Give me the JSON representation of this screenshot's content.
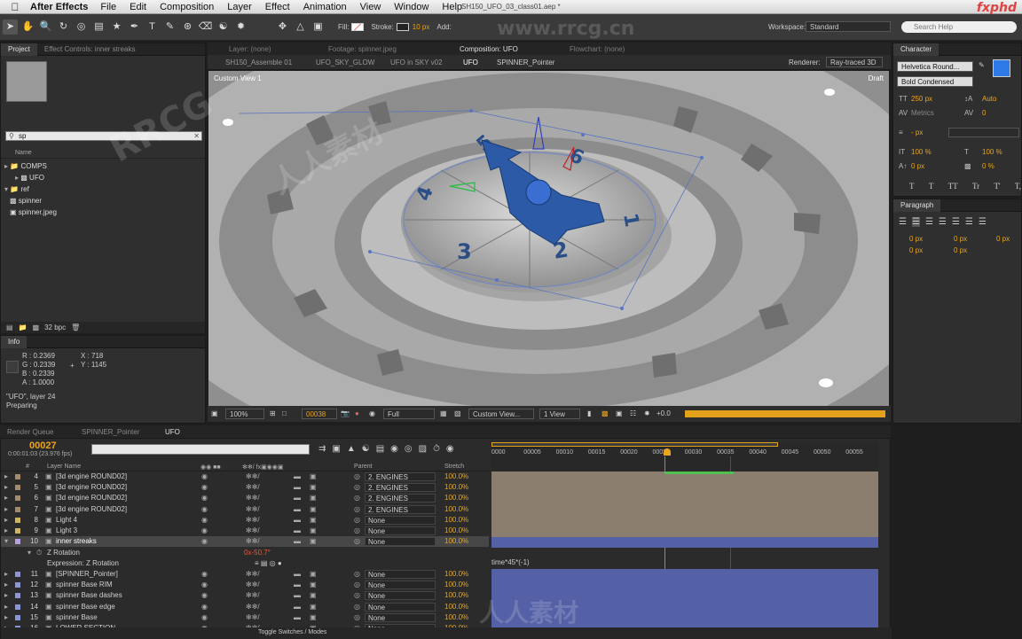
{
  "menubar": {
    "app": "After Effects",
    "items": [
      "File",
      "Edit",
      "Composition",
      "Layer",
      "Effect",
      "Animation",
      "View",
      "Window",
      "Help"
    ],
    "document": "SH150_UFO_03_class01.aep *"
  },
  "toolbar": {
    "fill_label": "Fill:",
    "stroke_label": "Stroke:",
    "stroke_width": "10 px",
    "add_label": "Add:",
    "workspace_label": "Workspace:",
    "workspace_value": "Standard",
    "search_placeholder": "Search Help"
  },
  "project": {
    "tabs": [
      "Project",
      "Effect Controls: inner streaks"
    ],
    "search_value": "sp",
    "column_name": "Name",
    "tree": [
      {
        "label": "COMPS",
        "type": "folder",
        "indent": 0
      },
      {
        "label": "UFO",
        "type": "comp",
        "indent": 1
      },
      {
        "label": "ref",
        "type": "folder",
        "indent": 0
      },
      {
        "label": "spinner",
        "type": "comp",
        "indent": 1
      },
      {
        "label": "spinner.jpeg",
        "type": "image",
        "indent": 1
      }
    ],
    "bpc": "32 bpc"
  },
  "info": {
    "tab": "Info",
    "r": "R : 0.2369",
    "g": "G : 0.2339",
    "b": "B : 0.2339",
    "a": "A : 1.0000",
    "x": "X : 718",
    "y": "Y : 1145",
    "status1": "\"UFO\", layer 24",
    "status2": "Preparing"
  },
  "viewer_tabs": {
    "layer": "Layer: (none)",
    "footage": "Footage: spinner.jpeg",
    "composition": "Composition: UFO",
    "flowchart": "Flowchart: (none)"
  },
  "breadcrumbs": [
    "SH150_Assemble 01",
    "UFO_SKY_GLOW",
    "UFO in SKY v02",
    "UFO",
    "SPINNER_Pointer"
  ],
  "renderer_label": "Renderer:",
  "renderer_value": "Ray-traced 3D",
  "viewer": {
    "view_name": "Custom View 1",
    "draft": "Draft",
    "zoom": "100%",
    "timecode": "00038",
    "resolution": "Full",
    "view": "Custom View...",
    "views": "1 View",
    "exposure": "+0.0"
  },
  "character": {
    "tab": "Character",
    "font": "Helvetica Round...",
    "style": "Bold Condensed",
    "size": "250 px",
    "leading": "Auto",
    "kerning": "Metrics",
    "tracking": "0",
    "stroke_width": "- px",
    "vscale": "100 %",
    "hscale": "100 %",
    "baseline": "0 px",
    "tsume": "0 %",
    "styles": [
      "T",
      "T",
      "TT",
      "Tr",
      "T'",
      "T,"
    ]
  },
  "paragraph": {
    "tab": "Paragraph",
    "indent_left": "0 px",
    "indent_right": "0 px",
    "indent_first": "0 px",
    "space_before": "0 px",
    "space_after": "0 px"
  },
  "timeline": {
    "tabs": [
      "Render Queue",
      "SPINNER_Pointer",
      "UFO"
    ],
    "timecode": "00027",
    "subtime": "0:00:01:03 (23.976 fps)",
    "col_layer": "Layer Name",
    "col_parent": "Parent",
    "col_stretch": "Stretch",
    "ruler": [
      "0000",
      "00005",
      "00010",
      "00015",
      "00020",
      "00025",
      "00030",
      "00035",
      "00040",
      "00045",
      "00050",
      "00055"
    ],
    "layers": [
      {
        "num": "4",
        "name": "[3d engine ROUND02]",
        "parent": "2. ENGINES",
        "stretch": "100.0%"
      },
      {
        "num": "5",
        "name": "[3d engine ROUND02]",
        "parent": "2. ENGINES",
        "stretch": "100.0%"
      },
      {
        "num": "6",
        "name": "[3d engine ROUND02]",
        "parent": "2. ENGINES",
        "stretch": "100.0%"
      },
      {
        "num": "7",
        "name": "[3d engine ROUND02]",
        "parent": "2. ENGINES",
        "stretch": "100.0%"
      },
      {
        "num": "8",
        "name": "Light 4",
        "parent": "None",
        "stretch": "100.0%"
      },
      {
        "num": "9",
        "name": "Light 3",
        "parent": "None",
        "stretch": "100.0%"
      },
      {
        "num": "10",
        "name": "inner streaks",
        "parent": "None",
        "stretch": "100.0%"
      }
    ],
    "z_rotation_label": "Z Rotation",
    "z_rotation_value": "0x-50.7°",
    "expression_label": "Expression: Z Rotation",
    "expression_text": "time*45*(-1)",
    "layers2": [
      {
        "num": "11",
        "name": "[SPINNER_Pointer]",
        "parent": "None",
        "stretch": "100.0%"
      },
      {
        "num": "12",
        "name": "spinner Base RIM",
        "parent": "None",
        "stretch": "100.0%"
      },
      {
        "num": "13",
        "name": "spinner Base dashes",
        "parent": "None",
        "stretch": "100.0%"
      },
      {
        "num": "14",
        "name": "spinner Base edge",
        "parent": "None",
        "stretch": "100.0%"
      },
      {
        "num": "15",
        "name": "spinner Base",
        "parent": "None",
        "stretch": "100.0%"
      },
      {
        "num": "16",
        "name": "LOWER SECTION",
        "parent": "None",
        "stretch": "100.0%"
      }
    ],
    "toggle_label": "Toggle Switches / Modes"
  },
  "watermarks": [
    "RRCG",
    "人人素材",
    "www.rrcg.cn",
    "人人素材"
  ],
  "logo": "fxphd"
}
